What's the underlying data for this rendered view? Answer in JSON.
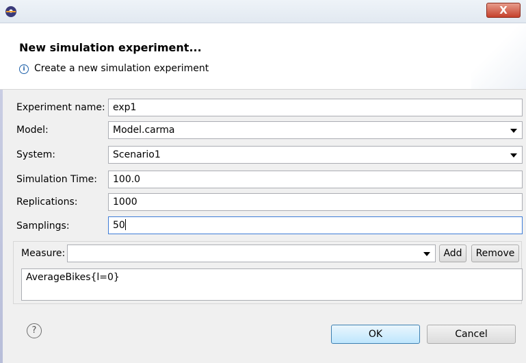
{
  "dialog": {
    "title": "New simulation experiment...",
    "message": "Create a new simulation experiment",
    "close_label": "X"
  },
  "form": {
    "experiment_name": {
      "label": "Experiment name:",
      "value": "exp1"
    },
    "model": {
      "label": "Model:",
      "value": "Model.carma"
    },
    "system": {
      "label": "System:",
      "value": "Scenario1"
    },
    "simulation_time": {
      "label": "Simulation Time:",
      "value": "100.0"
    },
    "replications": {
      "label": "Replications:",
      "value": "1000"
    },
    "samplings": {
      "label": "Samplings:",
      "value": "50"
    }
  },
  "measures": {
    "label": "Measure:",
    "selected": "",
    "add_label": "Add",
    "remove_label": "Remove",
    "items": [
      "AverageBikes{l=0}"
    ]
  },
  "buttons": {
    "help_glyph": "?",
    "ok_label": "OK",
    "cancel_label": "Cancel"
  },
  "icons": {
    "app": "eclipse-icon",
    "info": "info-icon",
    "help": "help-icon",
    "dropdown": "chevron-down-icon"
  }
}
